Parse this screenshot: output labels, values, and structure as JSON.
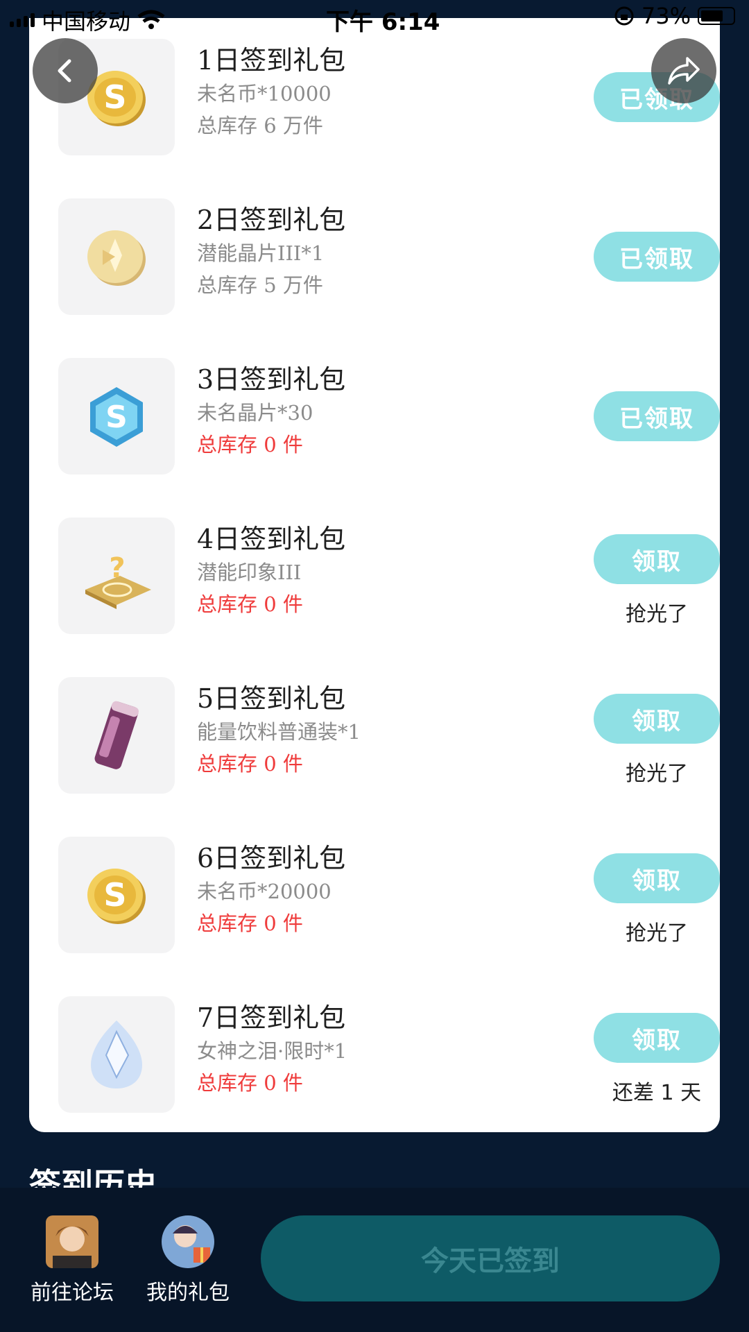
{
  "status": {
    "carrier": "中国移动",
    "time": "下午 6:14",
    "battery": "73%"
  },
  "rewards": [
    {
      "title": "1日签到礼包",
      "desc": "未名币*10000",
      "stock": "总库存 6 万件",
      "stock_empty": false,
      "button": "已领取",
      "note": "",
      "icon": "coin-icon"
    },
    {
      "title": "2日签到礼包",
      "desc": "潜能晶片III*1",
      "stock": "总库存 5 万件",
      "stock_empty": false,
      "button": "已领取",
      "note": "",
      "icon": "potential-chip-icon"
    },
    {
      "title": "3日签到礼包",
      "desc": "未名晶片*30",
      "stock": "总库存 0 件",
      "stock_empty": true,
      "button": "已领取",
      "note": "",
      "icon": "crystal-chip-icon"
    },
    {
      "title": "4日签到礼包",
      "desc": "潜能印象III",
      "stock": "总库存 0 件",
      "stock_empty": true,
      "button": "领取",
      "note": "抢光了",
      "icon": "impression-icon"
    },
    {
      "title": "5日签到礼包",
      "desc": "能量饮料普通装*1",
      "stock": "总库存 0 件",
      "stock_empty": true,
      "button": "领取",
      "note": "抢光了",
      "icon": "energy-drink-icon"
    },
    {
      "title": "6日签到礼包",
      "desc": "未名币*20000",
      "stock": "总库存 0 件",
      "stock_empty": true,
      "button": "领取",
      "note": "抢光了",
      "icon": "coin-icon"
    },
    {
      "title": "7日签到礼包",
      "desc": "女神之泪·限时*1",
      "stock": "总库存 0 件",
      "stock_empty": true,
      "button": "领取",
      "note": "还差 1 天",
      "icon": "tear-gem-icon"
    }
  ],
  "history_title": "签到历史",
  "bottom": {
    "forum_label": "前往论坛",
    "gift_label": "我的礼包",
    "checked_in_label": "今天已签到"
  },
  "colors": {
    "accent": "#8fe0e4",
    "danger": "#ef3b3b",
    "background": "#081a31"
  }
}
